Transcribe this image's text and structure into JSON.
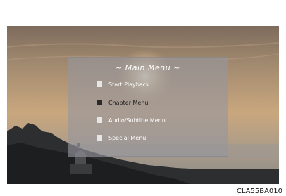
{
  "menu": {
    "title": "~  Main Menu  ~",
    "items": [
      {
        "label": "Start Playback",
        "selected": false
      },
      {
        "label": "Chapter Menu",
        "selected": true
      },
      {
        "label": "Audio/Subtitle Menu",
        "selected": false
      },
      {
        "label": "Special Menu",
        "selected": false
      }
    ]
  },
  "caption": "CLA55BA010"
}
